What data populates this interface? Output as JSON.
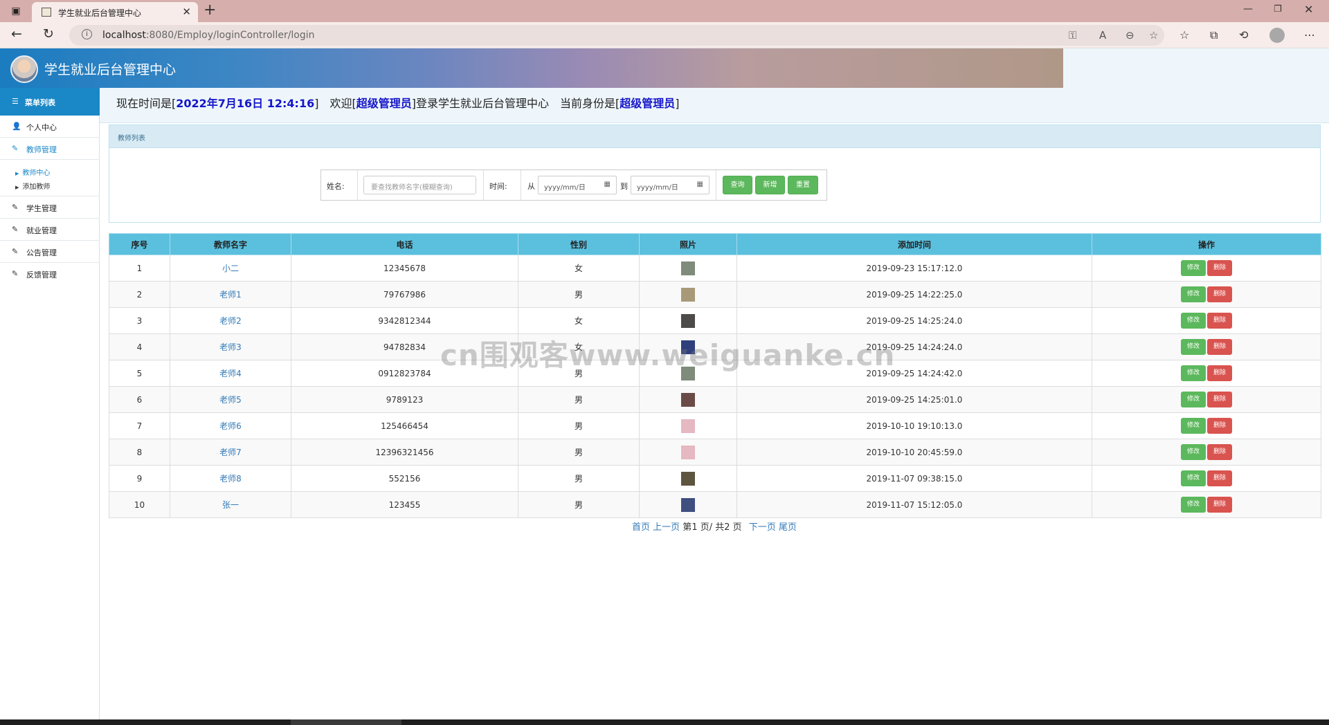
{
  "browser": {
    "tab_title": "学生就业后台管理中心",
    "url_host": "localhost",
    "url_rest": ":8080/Employ/loginController/login"
  },
  "header": {
    "title": "学生就业后台管理中心"
  },
  "sidebar": {
    "menu_title": "菜单列表",
    "items": [
      {
        "label": "个人中心"
      },
      {
        "label": "教师管理"
      },
      {
        "label": "学生管理"
      },
      {
        "label": "就业管理"
      },
      {
        "label": "公告管理"
      },
      {
        "label": "反馈管理"
      }
    ],
    "sub_items": [
      {
        "label": "教师中心"
      },
      {
        "label": "添加教师"
      }
    ]
  },
  "status": {
    "time_prefix": "现在时间是[",
    "time_value": "2022年7月16日 12:4:16",
    "time_suffix": "]",
    "welcome_prefix": "欢迎[",
    "user_name": "超级管理员",
    "welcome_suffix": "]登录学生就业后台管理中心",
    "role_prefix": "当前身份是[",
    "role_value": "超级管理员",
    "role_suffix": "]"
  },
  "panel": {
    "title": "教师列表"
  },
  "search": {
    "name_label": "姓名:",
    "name_placeholder": "要查找教师名字(模糊查询)",
    "time_label": "时间:",
    "from_label": "从",
    "date_placeholder": "yyyy/mm/日",
    "to_label": "到",
    "query_button": "查询",
    "add_button": "新增",
    "reset_button": "重置"
  },
  "table": {
    "headers": [
      "序号",
      "教师名字",
      "电话",
      "性别",
      "照片",
      "添加时间",
      "操作"
    ],
    "edit_label": "修改",
    "delete_label": "删除",
    "rows": [
      {
        "no": "1",
        "name": "小二",
        "phone": "12345678",
        "gender": "女",
        "added": "2019-09-23 15:17:12.0",
        "photo_color": "#7f8b7b"
      },
      {
        "no": "2",
        "name": "老师1",
        "phone": "79767986",
        "gender": "男",
        "added": "2019-09-25 14:22:25.0",
        "photo_color": "#a89a78"
      },
      {
        "no": "3",
        "name": "老师2",
        "phone": "9342812344",
        "gender": "女",
        "added": "2019-09-25 14:25:24.0",
        "photo_color": "#4e4a4a"
      },
      {
        "no": "4",
        "name": "老师3",
        "phone": "94782834",
        "gender": "女",
        "added": "2019-09-25 14:24:24.0",
        "photo_color": "#2e3f7c"
      },
      {
        "no": "5",
        "name": "老师4",
        "phone": "0912823784",
        "gender": "男",
        "added": "2019-09-25 14:24:42.0",
        "photo_color": "#7f8b7b"
      },
      {
        "no": "6",
        "name": "老师5",
        "phone": "9789123",
        "gender": "男",
        "added": "2019-09-25 14:25:01.0",
        "photo_color": "#6b4b48"
      },
      {
        "no": "7",
        "name": "老师6",
        "phone": "125466454",
        "gender": "男",
        "added": "2019-10-10 19:10:13.0",
        "photo_color": "#e5b8c2"
      },
      {
        "no": "8",
        "name": "老师7",
        "phone": "12396321456",
        "gender": "男",
        "added": "2019-10-10 20:45:59.0",
        "photo_color": "#e5b8c2"
      },
      {
        "no": "9",
        "name": "老师8",
        "phone": "552156",
        "gender": "男",
        "added": "2019-11-07 09:38:15.0",
        "photo_color": "#5d5540"
      },
      {
        "no": "10",
        "name": "张一",
        "phone": "123455",
        "gender": "男",
        "added": "2019-11-07 15:12:05.0",
        "photo_color": "#3f4f80"
      }
    ]
  },
  "pager": {
    "first": "首页",
    "prev": "上一页",
    "current_prefix": "第",
    "current_page": "1",
    "current_mid": "页/ 共",
    "total_pages": "2",
    "current_suffix": "页",
    "next": "下一页",
    "last": "尾页"
  },
  "watermark": "cn围观客www.weiguanke.cn"
}
